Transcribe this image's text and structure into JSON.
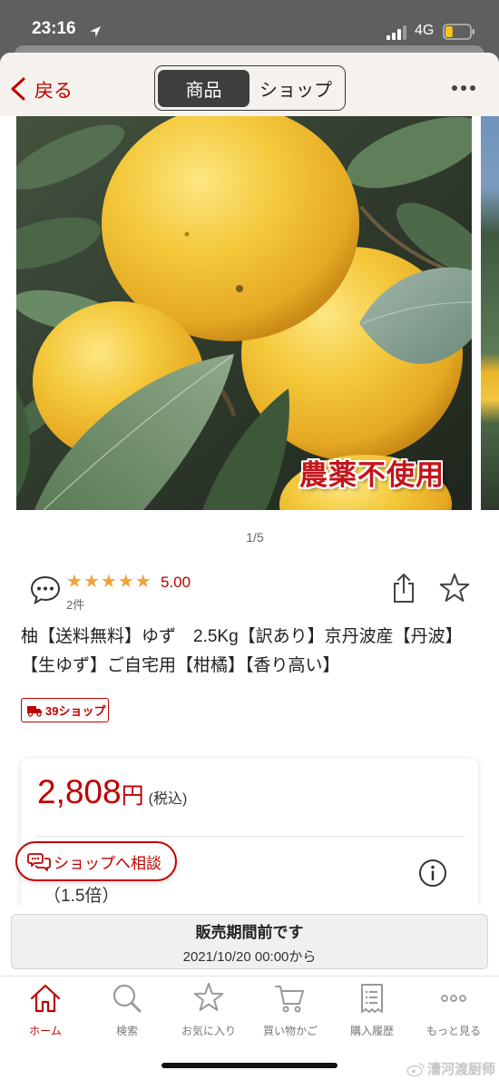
{
  "status_bar": {
    "time": "23:16",
    "network": "4G",
    "battery_level": 0.3
  },
  "header": {
    "back_label": "戻る",
    "segments": [
      {
        "label": "商品",
        "selected": true
      },
      {
        "label": "ショップ",
        "selected": false
      }
    ],
    "more_icon": "more-dots-icon"
  },
  "gallery": {
    "overlay_text": "農薬不使用",
    "page_indicator": "1/5"
  },
  "rating": {
    "stars": 5,
    "score": "5.00",
    "review_count": "2件"
  },
  "product": {
    "title": "柚【送料無料】ゆず　2.5Kg【訳あり】京丹波産【丹波】【生ゆず】ご自宅用【柑橘】【香り高い】",
    "badge": "39ショップ"
  },
  "price": {
    "amount": "2,808",
    "currency": "円",
    "tax_note": "(税込)",
    "points_multiplier": "（1.5倍）"
  },
  "consult_button": {
    "label": "ショップへ相談"
  },
  "sale_notice": {
    "title": "販売期間前です",
    "start": "2021/10/20 00:00から"
  },
  "tab_bar": {
    "items": [
      {
        "label": "ホーム",
        "icon": "home-icon",
        "active": true
      },
      {
        "label": "検索",
        "icon": "search-icon",
        "active": false
      },
      {
        "label": "お気に入り",
        "icon": "star-icon",
        "active": false
      },
      {
        "label": "買い物かご",
        "icon": "cart-icon",
        "active": false
      },
      {
        "label": "購入履歴",
        "icon": "receipt-icon",
        "active": false
      },
      {
        "label": "もっと見る",
        "icon": "more-icon",
        "active": false
      }
    ]
  },
  "watermark": "漕河渡厨师",
  "colors": {
    "accent": "#bf0000",
    "star": "#f0a33a",
    "battery": "#f5c518"
  }
}
